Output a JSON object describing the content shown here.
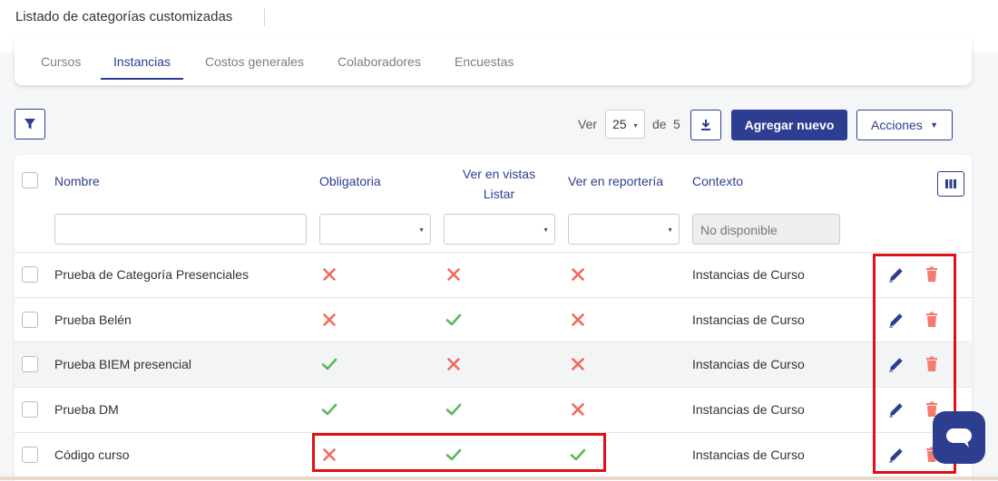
{
  "header": {
    "title": "Listado de categorías customizadas"
  },
  "tabs": [
    {
      "label": "Cursos",
      "active": false
    },
    {
      "label": "Instancias",
      "active": true
    },
    {
      "label": "Costos generales",
      "active": false
    },
    {
      "label": "Colaboradores",
      "active": false
    },
    {
      "label": "Encuestas",
      "active": false
    }
  ],
  "toolbar": {
    "filter_icon": "filter-icon",
    "ver_label": "Ver",
    "page_size": "25",
    "de_label": "de",
    "total_pages": "5",
    "download_icon": "download-icon",
    "add_label": "Agregar nuevo",
    "actions_label": "Acciones"
  },
  "table": {
    "columns": {
      "nombre": "Nombre",
      "obligatoria": "Obligatoria",
      "ver_vistas_line1": "Ver en vistas",
      "ver_vistas_line2": "Listar",
      "ver_reporteria": "Ver en reportería",
      "contexto": "Contexto"
    },
    "filters": {
      "contexto_value": "No disponible"
    },
    "rows": [
      {
        "nombre": "Prueba de Categoría Presenciales",
        "obligatoria": false,
        "ver_vistas": false,
        "ver_reporteria": false,
        "contexto": "Instancias de Curso"
      },
      {
        "nombre": "Prueba Belén",
        "obligatoria": false,
        "ver_vistas": true,
        "ver_reporteria": false,
        "contexto": "Instancias de Curso"
      },
      {
        "nombre": "Prueba BIEM presencial",
        "obligatoria": true,
        "ver_vistas": false,
        "ver_reporteria": false,
        "contexto": "Instancias de Curso"
      },
      {
        "nombre": "Prueba DM",
        "obligatoria": true,
        "ver_vistas": true,
        "ver_reporteria": false,
        "contexto": "Instancias de Curso"
      },
      {
        "nombre": "Código curso",
        "obligatoria": false,
        "ver_vistas": true,
        "ver_reporteria": true,
        "contexto": "Instancias de Curso"
      }
    ]
  },
  "colors": {
    "primary": "#2d3e91",
    "check": "#5cb85c",
    "cross": "#f06a5c",
    "delete": "#f47c6e",
    "highlight": "#e10f18"
  },
  "icons": {
    "check": "check-icon",
    "cross": "cross-icon",
    "edit": "pencil-icon",
    "delete": "trash-icon",
    "columns": "columns-icon",
    "chat": "chat-icon"
  }
}
